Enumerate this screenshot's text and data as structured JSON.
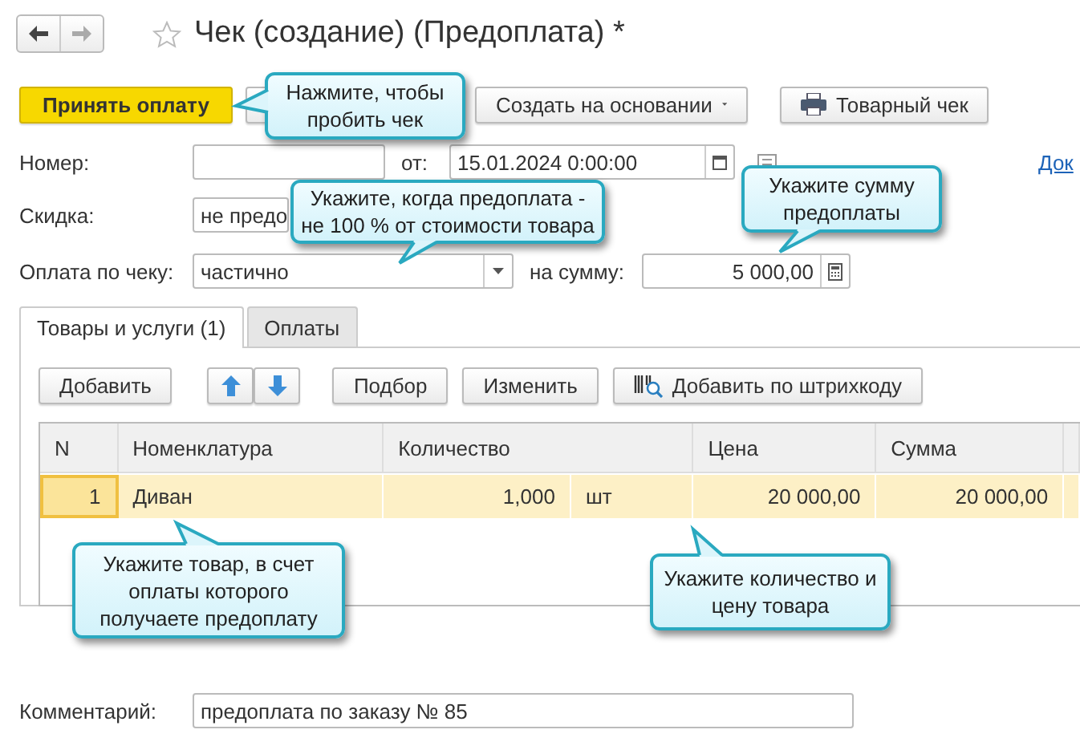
{
  "window": {
    "title": "Чек (создание) (Предоплата) *"
  },
  "toolbar": [
    {
      "label": "Принять оплату",
      "kind": "primary"
    },
    {
      "label": "Создать на основании",
      "kind": "menu"
    },
    {
      "label": "Товарный чек",
      "kind": "print"
    }
  ],
  "header": {
    "number_label": "Номер:",
    "date_label": "от:",
    "date_value": "15.01.2024 0:00:00",
    "link": "Док",
    "discount_label": "Скидка:",
    "discount_value": "не предо",
    "payment_label": "Оплата по чеку:",
    "payment_value": "частично",
    "amount_label": "на сумму:",
    "amount_value": "5 000,00"
  },
  "tabs": [
    {
      "label": "Товары и услуги (1)",
      "selected": true
    },
    {
      "label": "Оплаты",
      "selected": false
    }
  ],
  "table_toolbar": [
    {
      "label": "Добавить",
      "kind": "plain"
    },
    {
      "kind": "up"
    },
    {
      "kind": "down"
    },
    {
      "label": "Подбор",
      "kind": "plain"
    },
    {
      "label": "Изменить",
      "kind": "plain"
    },
    {
      "label": "Добавить по штрихкоду",
      "kind": "barcode"
    }
  ],
  "table": {
    "columns": [
      "N",
      "Номенклатура",
      "Количество",
      "Цена",
      "Сумма"
    ],
    "rows": [
      {
        "n": "1",
        "item": "Диван",
        "quantity": "1,000",
        "unit": "шт",
        "price": "20 000,00",
        "sum": "20 000,00",
        "selected": true
      }
    ]
  },
  "comment": {
    "label": "Комментарий:",
    "value": "предоплата по заказу № 85"
  },
  "callouts": [
    {
      "lines": [
        "Нажмите, чтобы",
        "пробить чек"
      ]
    },
    {
      "lines": [
        "Укажите, когда предоплата -",
        "не 100 % от стоимости товара"
      ]
    },
    {
      "lines": [
        "Укажите сумму",
        "предоплаты"
      ]
    },
    {
      "lines": [
        "Укажите товар, в счет",
        "оплаты которого",
        "получаете предоплату"
      ]
    },
    {
      "lines": [
        "Укажите количество и",
        "цену товара"
      ]
    }
  ]
}
